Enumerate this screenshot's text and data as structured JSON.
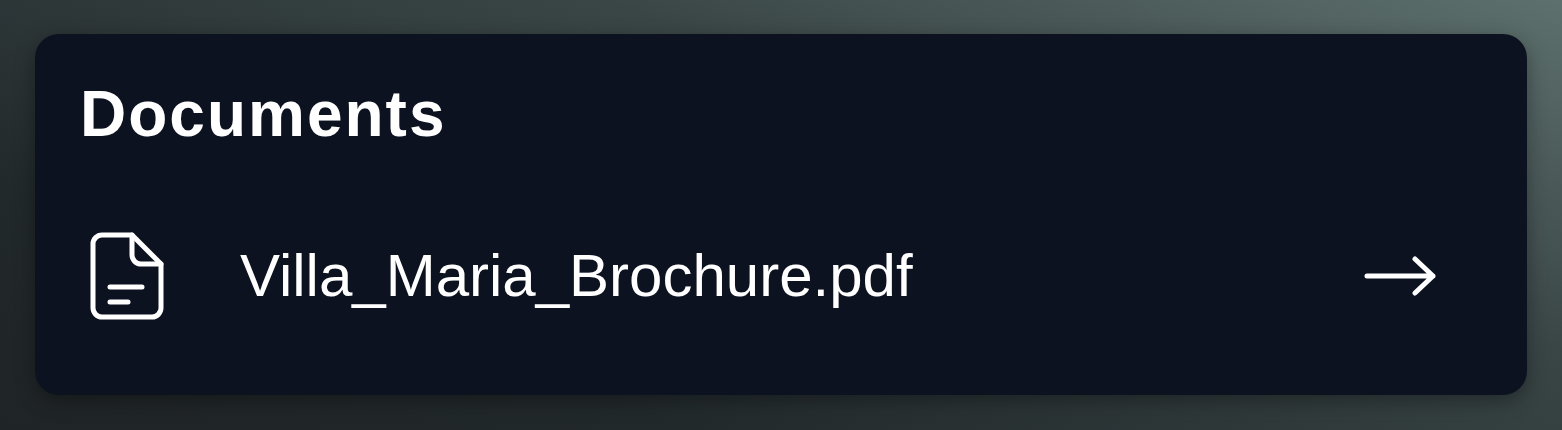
{
  "card": {
    "title": "Documents",
    "documents": [
      {
        "name": "Villa_Maria_Brochure.pdf"
      }
    ]
  }
}
